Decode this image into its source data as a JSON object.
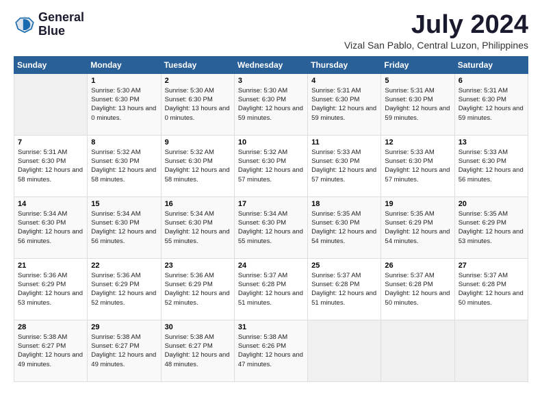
{
  "logo": {
    "line1": "General",
    "line2": "Blue"
  },
  "title": "July 2024",
  "location": "Vizal San Pablo, Central Luzon, Philippines",
  "days_header": [
    "Sunday",
    "Monday",
    "Tuesday",
    "Wednesday",
    "Thursday",
    "Friday",
    "Saturday"
  ],
  "weeks": [
    [
      {
        "num": "",
        "rise": "",
        "set": "",
        "daylight": ""
      },
      {
        "num": "1",
        "rise": "Sunrise: 5:30 AM",
        "set": "Sunset: 6:30 PM",
        "daylight": "Daylight: 13 hours and 0 minutes."
      },
      {
        "num": "2",
        "rise": "Sunrise: 5:30 AM",
        "set": "Sunset: 6:30 PM",
        "daylight": "Daylight: 13 hours and 0 minutes."
      },
      {
        "num": "3",
        "rise": "Sunrise: 5:30 AM",
        "set": "Sunset: 6:30 PM",
        "daylight": "Daylight: 12 hours and 59 minutes."
      },
      {
        "num": "4",
        "rise": "Sunrise: 5:31 AM",
        "set": "Sunset: 6:30 PM",
        "daylight": "Daylight: 12 hours and 59 minutes."
      },
      {
        "num": "5",
        "rise": "Sunrise: 5:31 AM",
        "set": "Sunset: 6:30 PM",
        "daylight": "Daylight: 12 hours and 59 minutes."
      },
      {
        "num": "6",
        "rise": "Sunrise: 5:31 AM",
        "set": "Sunset: 6:30 PM",
        "daylight": "Daylight: 12 hours and 59 minutes."
      }
    ],
    [
      {
        "num": "7",
        "rise": "Sunrise: 5:31 AM",
        "set": "Sunset: 6:30 PM",
        "daylight": "Daylight: 12 hours and 58 minutes."
      },
      {
        "num": "8",
        "rise": "Sunrise: 5:32 AM",
        "set": "Sunset: 6:30 PM",
        "daylight": "Daylight: 12 hours and 58 minutes."
      },
      {
        "num": "9",
        "rise": "Sunrise: 5:32 AM",
        "set": "Sunset: 6:30 PM",
        "daylight": "Daylight: 12 hours and 58 minutes."
      },
      {
        "num": "10",
        "rise": "Sunrise: 5:32 AM",
        "set": "Sunset: 6:30 PM",
        "daylight": "Daylight: 12 hours and 57 minutes."
      },
      {
        "num": "11",
        "rise": "Sunrise: 5:33 AM",
        "set": "Sunset: 6:30 PM",
        "daylight": "Daylight: 12 hours and 57 minutes."
      },
      {
        "num": "12",
        "rise": "Sunrise: 5:33 AM",
        "set": "Sunset: 6:30 PM",
        "daylight": "Daylight: 12 hours and 57 minutes."
      },
      {
        "num": "13",
        "rise": "Sunrise: 5:33 AM",
        "set": "Sunset: 6:30 PM",
        "daylight": "Daylight: 12 hours and 56 minutes."
      }
    ],
    [
      {
        "num": "14",
        "rise": "Sunrise: 5:34 AM",
        "set": "Sunset: 6:30 PM",
        "daylight": "Daylight: 12 hours and 56 minutes."
      },
      {
        "num": "15",
        "rise": "Sunrise: 5:34 AM",
        "set": "Sunset: 6:30 PM",
        "daylight": "Daylight: 12 hours and 56 minutes."
      },
      {
        "num": "16",
        "rise": "Sunrise: 5:34 AM",
        "set": "Sunset: 6:30 PM",
        "daylight": "Daylight: 12 hours and 55 minutes."
      },
      {
        "num": "17",
        "rise": "Sunrise: 5:34 AM",
        "set": "Sunset: 6:30 PM",
        "daylight": "Daylight: 12 hours and 55 minutes."
      },
      {
        "num": "18",
        "rise": "Sunrise: 5:35 AM",
        "set": "Sunset: 6:30 PM",
        "daylight": "Daylight: 12 hours and 54 minutes."
      },
      {
        "num": "19",
        "rise": "Sunrise: 5:35 AM",
        "set": "Sunset: 6:29 PM",
        "daylight": "Daylight: 12 hours and 54 minutes."
      },
      {
        "num": "20",
        "rise": "Sunrise: 5:35 AM",
        "set": "Sunset: 6:29 PM",
        "daylight": "Daylight: 12 hours and 53 minutes."
      }
    ],
    [
      {
        "num": "21",
        "rise": "Sunrise: 5:36 AM",
        "set": "Sunset: 6:29 PM",
        "daylight": "Daylight: 12 hours and 53 minutes."
      },
      {
        "num": "22",
        "rise": "Sunrise: 5:36 AM",
        "set": "Sunset: 6:29 PM",
        "daylight": "Daylight: 12 hours and 52 minutes."
      },
      {
        "num": "23",
        "rise": "Sunrise: 5:36 AM",
        "set": "Sunset: 6:29 PM",
        "daylight": "Daylight: 12 hours and 52 minutes."
      },
      {
        "num": "24",
        "rise": "Sunrise: 5:37 AM",
        "set": "Sunset: 6:28 PM",
        "daylight": "Daylight: 12 hours and 51 minutes."
      },
      {
        "num": "25",
        "rise": "Sunrise: 5:37 AM",
        "set": "Sunset: 6:28 PM",
        "daylight": "Daylight: 12 hours and 51 minutes."
      },
      {
        "num": "26",
        "rise": "Sunrise: 5:37 AM",
        "set": "Sunset: 6:28 PM",
        "daylight": "Daylight: 12 hours and 50 minutes."
      },
      {
        "num": "27",
        "rise": "Sunrise: 5:37 AM",
        "set": "Sunset: 6:28 PM",
        "daylight": "Daylight: 12 hours and 50 minutes."
      }
    ],
    [
      {
        "num": "28",
        "rise": "Sunrise: 5:38 AM",
        "set": "Sunset: 6:27 PM",
        "daylight": "Daylight: 12 hours and 49 minutes."
      },
      {
        "num": "29",
        "rise": "Sunrise: 5:38 AM",
        "set": "Sunset: 6:27 PM",
        "daylight": "Daylight: 12 hours and 49 minutes."
      },
      {
        "num": "30",
        "rise": "Sunrise: 5:38 AM",
        "set": "Sunset: 6:27 PM",
        "daylight": "Daylight: 12 hours and 48 minutes."
      },
      {
        "num": "31",
        "rise": "Sunrise: 5:38 AM",
        "set": "Sunset: 6:26 PM",
        "daylight": "Daylight: 12 hours and 47 minutes."
      },
      {
        "num": "",
        "rise": "",
        "set": "",
        "daylight": ""
      },
      {
        "num": "",
        "rise": "",
        "set": "",
        "daylight": ""
      },
      {
        "num": "",
        "rise": "",
        "set": "",
        "daylight": ""
      }
    ]
  ]
}
